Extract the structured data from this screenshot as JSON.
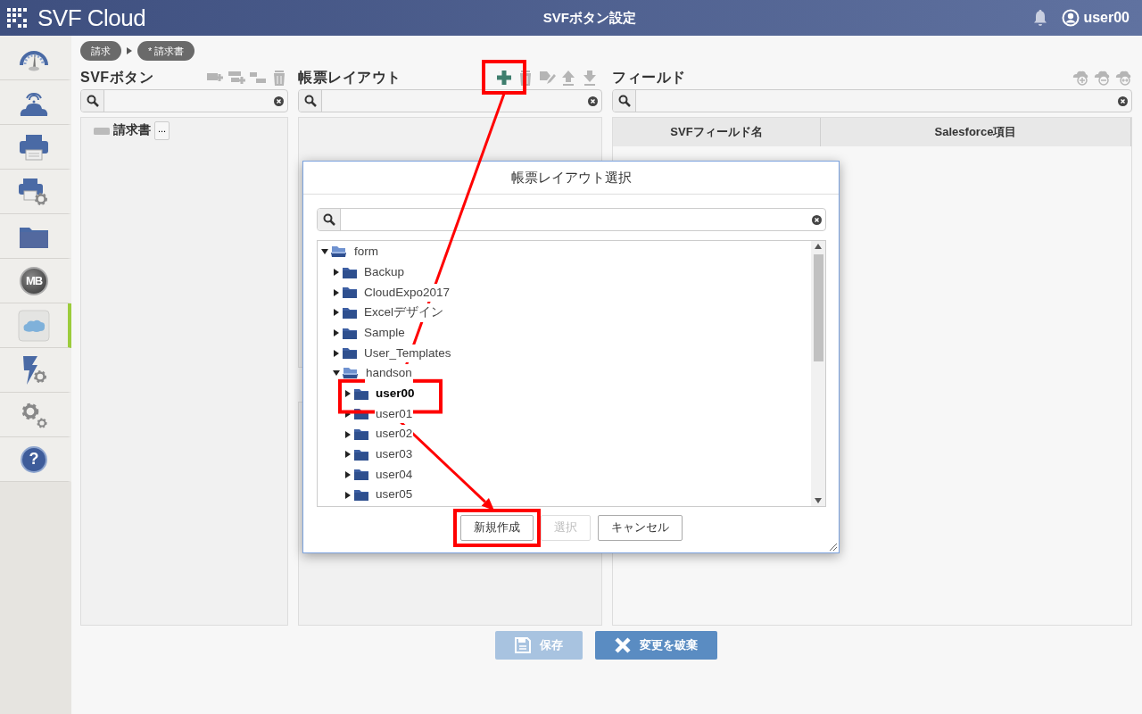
{
  "header": {
    "logo": "SVF Cloud",
    "title": "SVFボタン設定",
    "user": "user00"
  },
  "sidebar": {
    "items": [
      {
        "kind": "dashboard",
        "selected": false
      },
      {
        "kind": "cloud",
        "selected": false
      },
      {
        "kind": "printer",
        "selected": false
      },
      {
        "kind": "printer-settings",
        "selected": false
      },
      {
        "kind": "folder",
        "selected": false
      },
      {
        "kind": "badge",
        "label": "MB",
        "selected": false
      },
      {
        "kind": "salesforce",
        "selected": true
      },
      {
        "kind": "action-settings",
        "selected": false
      },
      {
        "kind": "settings",
        "selected": false
      },
      {
        "kind": "help",
        "label": "?",
        "selected": false
      }
    ]
  },
  "breadcrumb": [
    "請求",
    "* 請求書"
  ],
  "svf_buttons": {
    "title": "SVFボタン",
    "toolbar": [
      {
        "kind": "add",
        "disabled": true
      },
      {
        "kind": "add-child",
        "disabled": true
      },
      {
        "kind": "indent",
        "disabled": true
      },
      {
        "kind": "delete",
        "disabled": true
      }
    ],
    "tree": [
      {
        "label": "請求書",
        "more": "..."
      }
    ]
  },
  "layouts": {
    "title": "帳票レイアウト",
    "toolbar": [
      {
        "kind": "plus",
        "disabled": false
      },
      {
        "kind": "delete",
        "disabled": true
      },
      {
        "kind": "edit",
        "disabled": true
      },
      {
        "kind": "up",
        "disabled": true
      },
      {
        "kind": "down",
        "disabled": true
      }
    ]
  },
  "fields": {
    "title": "フィールド",
    "toolbar": [
      {
        "kind": "cloud-add",
        "disabled": true
      },
      {
        "kind": "cloud-remove",
        "disabled": true
      },
      {
        "kind": "cloud-link",
        "disabled": true
      }
    ],
    "table": {
      "columns": [
        "SVFフィールド名",
        "Salesforce項目"
      ]
    }
  },
  "dialog": {
    "title": "帳票レイアウト選択",
    "tree": [
      {
        "label": "form",
        "expanded": true,
        "selected": false,
        "children": [
          {
            "label": "Backup",
            "expanded": false,
            "selected": false
          },
          {
            "label": "CloudExpo2017",
            "expanded": false,
            "selected": false
          },
          {
            "label": "Excelデザイン",
            "expanded": false,
            "selected": false
          },
          {
            "label": "Sample",
            "expanded": false,
            "selected": false
          },
          {
            "label": "User_Templates",
            "expanded": false,
            "selected": false
          },
          {
            "label": "handson",
            "expanded": true,
            "selected": false,
            "children": [
              {
                "label": "user00",
                "expanded": false,
                "selected": true
              },
              {
                "label": "user01",
                "expanded": false,
                "selected": false
              },
              {
                "label": "user02",
                "expanded": false,
                "selected": false
              },
              {
                "label": "user03",
                "expanded": false,
                "selected": false
              },
              {
                "label": "user04",
                "expanded": false,
                "selected": false
              },
              {
                "label": "user05",
                "expanded": false,
                "selected": false
              }
            ]
          }
        ]
      }
    ],
    "buttons": [
      {
        "label": "新規作成",
        "disabled": false
      },
      {
        "label": "選択",
        "disabled": true
      },
      {
        "label": "キャンセル",
        "disabled": false
      }
    ]
  },
  "footer": [
    {
      "kind": "save",
      "label": "保存",
      "disabled": true
    },
    {
      "kind": "discard",
      "label": "変更を破棄",
      "disabled": false
    }
  ]
}
